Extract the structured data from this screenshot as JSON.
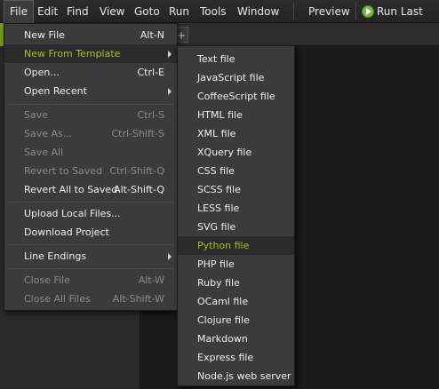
{
  "menubar": {
    "items": [
      "File",
      "Edit",
      "Find",
      "View",
      "Goto",
      "Run",
      "Tools",
      "Window"
    ],
    "preview": "Preview",
    "run_last": "Run Last",
    "active": "File"
  },
  "tabstrip": {
    "add_label": "+"
  },
  "file_menu": {
    "items": [
      {
        "label": "New File",
        "shortcut": "Alt-N",
        "enabled": true
      },
      {
        "label": "New From Template",
        "shortcut": "",
        "submenu": true,
        "highlighted": true
      },
      {
        "label": "Open...",
        "shortcut": "Ctrl-E",
        "enabled": true
      },
      {
        "label": "Open Recent",
        "shortcut": "",
        "submenu": true
      },
      {
        "label": "Save",
        "shortcut": "Ctrl-S",
        "enabled": false
      },
      {
        "label": "Save As...",
        "shortcut": "Ctrl-Shift-S",
        "enabled": false
      },
      {
        "label": "Save All",
        "shortcut": "",
        "enabled": false
      },
      {
        "label": "Revert to Saved",
        "shortcut": "Ctrl-Shift-Q",
        "enabled": false
      },
      {
        "label": "Revert All to Saved",
        "shortcut": "Alt-Shift-Q",
        "enabled": true
      },
      {
        "label": "Upload Local Files...",
        "shortcut": "",
        "enabled": true
      },
      {
        "label": "Download Project",
        "shortcut": "",
        "enabled": true
      },
      {
        "label": "Line Endings",
        "shortcut": "",
        "submenu": true
      },
      {
        "label": "Close File",
        "shortcut": "Alt-W",
        "enabled": false
      },
      {
        "label": "Close All Files",
        "shortcut": "Alt-Shift-W",
        "enabled": false
      }
    ]
  },
  "template_menu": {
    "items": [
      "Text file",
      "JavaScript file",
      "CoffeeScript file",
      "HTML file",
      "XML file",
      "XQuery file",
      "CSS file",
      "SCSS file",
      "LESS file",
      "SVG file",
      "Python file",
      "PHP file",
      "Ruby file",
      "OCaml file",
      "Clojure file",
      "Markdown",
      "Express file",
      "Node.js web server"
    ],
    "highlighted": "Python file"
  },
  "colors": {
    "accent": "#a8c31d",
    "menu_bg": "#3b3b3b",
    "highlight_bg": "#2b2b2b",
    "run_icon": "#7cb63b"
  }
}
